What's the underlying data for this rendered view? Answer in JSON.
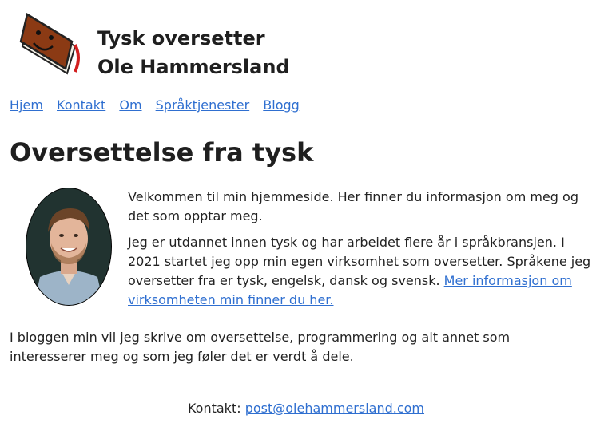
{
  "header": {
    "title_line1": "Tysk oversetter",
    "title_line2": "Ole Hammersland",
    "logo_icon": "smiling-book-icon"
  },
  "nav": {
    "items": [
      {
        "label": "Hjem"
      },
      {
        "label": "Kontakt"
      },
      {
        "label": "Om"
      },
      {
        "label": "Språktjenester"
      },
      {
        "label": "Blogg"
      }
    ]
  },
  "main": {
    "heading": "Oversettelse fra tysk",
    "intro_p1": "Velkommen til min hjemmeside. Her finner du informasjon om meg og det som opptar meg.",
    "intro_p2": "Jeg er utdannet innen tysk og har arbeidet flere år i språkbransjen. I 2021 startet jeg opp min egen virksomhet som oversetter. Språkene jeg oversetter fra er tysk, engelsk, dansk og svensk.",
    "intro_p2_link": "Mer informasjon om virksomheten min finner du her.",
    "blog_text": "I bloggen min vil jeg skrive om oversettelse, programmering og alt annet som interesserer meg og som jeg føler det er verdt å dele."
  },
  "footer": {
    "label": "Kontakt:",
    "email": "post@olehammersland.com"
  },
  "colors": {
    "link": "#2f6fd0",
    "text": "#222222",
    "book": "#8b3a14"
  }
}
